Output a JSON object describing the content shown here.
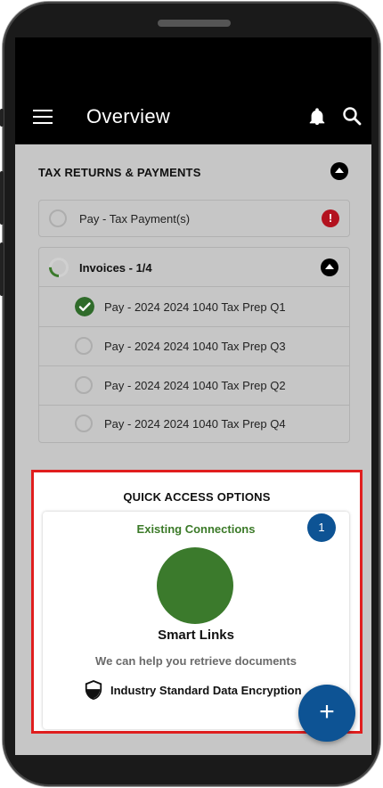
{
  "appbar": {
    "title": "Overview"
  },
  "tax_section": {
    "heading": "TAX RETURNS & PAYMENTS",
    "payment_row_label": "Pay - Tax Payment(s)",
    "alert_glyph": "!"
  },
  "invoices": {
    "heading": "Invoices - 1/4",
    "progress_fraction": 0.25,
    "items": [
      {
        "label": "Pay - 2024 2024 1040 Tax Prep Q1",
        "completed": true
      },
      {
        "label": "Pay - 2024 2024 1040 Tax Prep Q3",
        "completed": false
      },
      {
        "label": "Pay - 2024 2024 1040 Tax Prep Q2",
        "completed": false
      },
      {
        "label": "Pay - 2024 2024 1040 Tax Prep Q4",
        "completed": false
      }
    ]
  },
  "quick_access": {
    "heading": "QUICK ACCESS OPTIONS",
    "subheading": "Existing Connections",
    "badge_count": "1",
    "card_title": "Smart Links",
    "card_description": "We can help you retrieve documents",
    "encryption_label": "Industry Standard Data Encryption"
  },
  "fab": {
    "glyph": "+"
  },
  "colors": {
    "accent_blue": "#0d5394",
    "success_green": "#3b7a2c",
    "alert_red": "#b3121f",
    "highlight_border": "#e01e1e"
  },
  "icons": [
    "menu-icon",
    "bell-icon",
    "search-icon",
    "chevron-up-icon",
    "alert-icon",
    "check-icon",
    "shield-icon",
    "plus-icon"
  ]
}
